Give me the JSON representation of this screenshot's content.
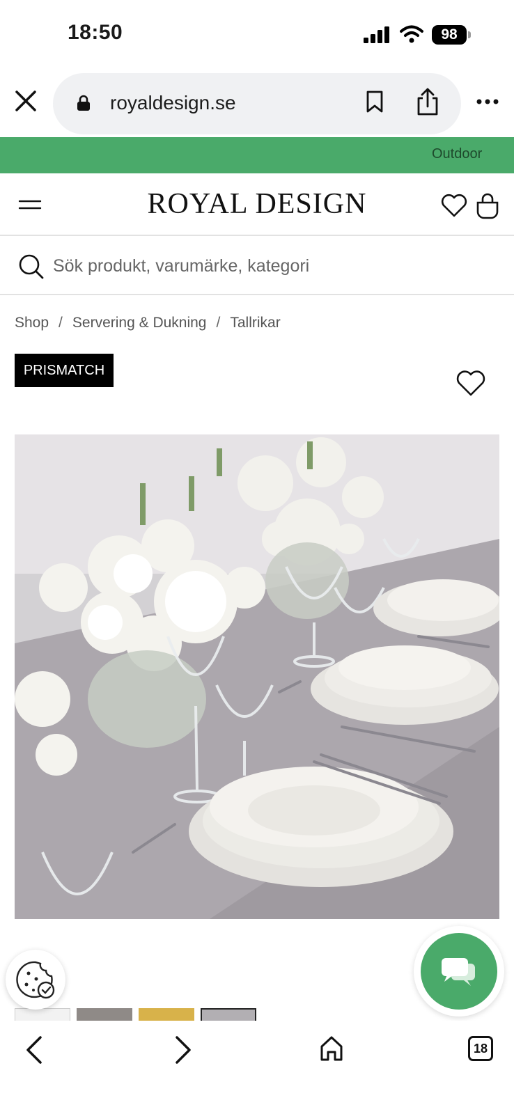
{
  "status_bar": {
    "time": "18:50",
    "battery": "98",
    "icons": [
      "signal-icon",
      "wifi-icon",
      "battery-icon"
    ]
  },
  "browser": {
    "url": "royaldesign.se",
    "icons": [
      "close-icon",
      "lock-icon",
      "bookmark-icon",
      "share-icon",
      "more-icon"
    ]
  },
  "promo_banner": {
    "text": "Outdoor",
    "color": "#4aaa6a"
  },
  "header": {
    "logo": "ROYAL DESIGN",
    "icons": [
      "hamburger-menu-icon",
      "heart-icon",
      "shopping-bag-icon"
    ]
  },
  "search": {
    "placeholder": "Sök produkt, varumärke, kategori"
  },
  "breadcrumb": {
    "items": [
      "Shop",
      "Servering & Dukning",
      "Tallrikar"
    ],
    "separator": "/"
  },
  "product": {
    "badge": "PRISMATCH",
    "image_description_icon": "product-photo"
  },
  "bottom_bar": {
    "tab_count": "18",
    "icons": [
      "back-arrow-icon",
      "forward-arrow-icon",
      "home-icon",
      "tabs-icon"
    ]
  },
  "colors": {
    "accent_green": "#4aaa6a",
    "badge_bg": "#000000",
    "url_pill_bg": "#f0f1f3"
  }
}
